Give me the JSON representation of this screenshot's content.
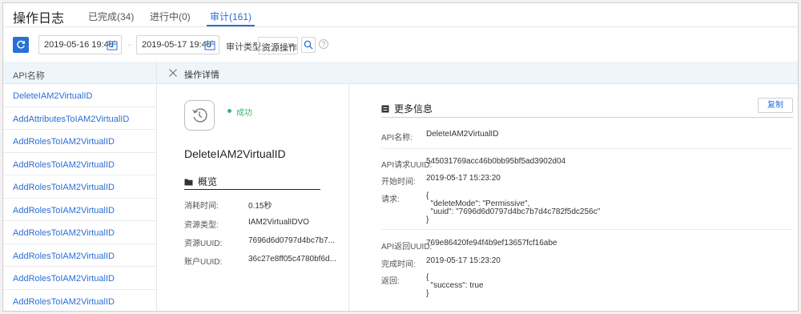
{
  "header": {
    "title": "操作日志",
    "tabs": [
      {
        "label": "已完成(34)"
      },
      {
        "label": "进行中(0)"
      },
      {
        "label": "审计(161)"
      }
    ],
    "accent_color": "#2a6fd6"
  },
  "toolbar": {
    "start_date": "2019-05-16 19:48",
    "date_separator": "-",
    "end_date": "2019-05-17 19:48",
    "filter_label": "审计类型:",
    "filter_value": "资源操作",
    "help_glyph": "?"
  },
  "api_list": {
    "header": "API名称",
    "items": [
      "DeleteIAM2VirtualID",
      "AddAttributesToIAM2VirtualID",
      "AddRolesToIAM2VirtualID",
      "AddRolesToIAM2VirtualID",
      "AddRolesToIAM2VirtualID",
      "AddRolesToIAM2VirtualID",
      "AddRolesToIAM2VirtualID",
      "AddRolesToIAM2VirtualID",
      "AddRolesToIAM2VirtualID",
      "AddRolesToIAM2VirtualID"
    ]
  },
  "detail": {
    "title": "操作详情",
    "status": "成功",
    "status_color": "#3cb371",
    "api_name": "DeleteIAM2VirtualID",
    "overview": {
      "title": "概览",
      "rows": [
        {
          "label": "消耗时间:",
          "value": "0.15秒"
        },
        {
          "label": "资源类型:",
          "value": "IAM2VirtualIDVO"
        },
        {
          "label": "资源UUID:",
          "value": "7696d6d0797d4bc7b7..."
        },
        {
          "label": "账户UUID:",
          "value": "36c27e8ff05c4780bf6d..."
        }
      ]
    },
    "more": {
      "title": "更多信息",
      "copy_label": "复制",
      "api_name_label": "API名称:",
      "api_name_value": "DeleteIAM2VirtualID",
      "request_uuid_label": "API请求UUID:",
      "request_uuid_value": "545031769acc46b0bb95bf5ad3902d04",
      "start_time_label": "开始时间:",
      "start_time_value": "2019-05-17 15:23:20",
      "request_label": "请求:",
      "request_value": "{\n  \"deleteMode\": \"Permissive\",\n  \"uuid\": \"7696d6d0797d4bc7b7d4c782f5dc256c\"\n}",
      "response_uuid_label": "API返回UUID:",
      "response_uuid_value": "769e86420fe94f4b9ef13657fcf16abe",
      "finish_time_label": "完成时间:",
      "finish_time_value": "2019-05-17 15:23:20",
      "return_label": "返回:",
      "return_value": "{\n  \"success\": true\n}"
    }
  }
}
